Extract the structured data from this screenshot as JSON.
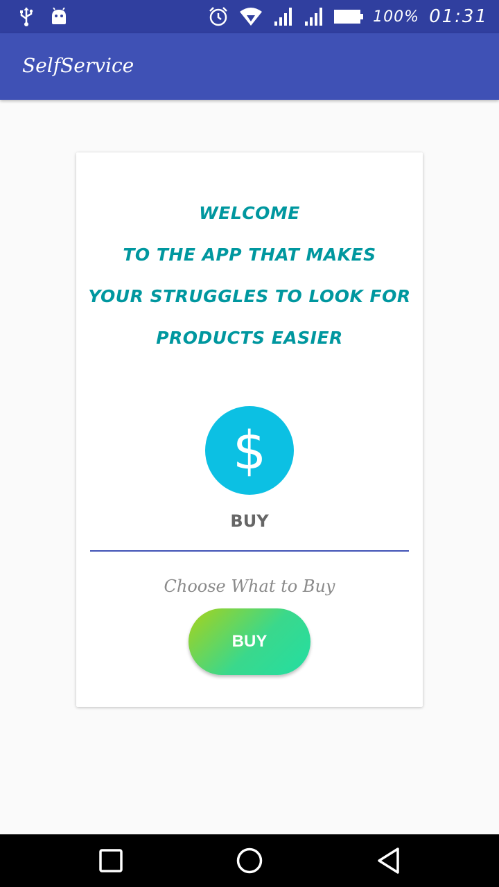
{
  "status_bar": {
    "battery_text": "100%",
    "time": "01:31",
    "icons": [
      "usb-icon",
      "android-icon",
      "alarm-icon",
      "wifi-icon",
      "signal-icon",
      "signal-icon",
      "battery-icon"
    ]
  },
  "app_bar": {
    "title": "SelfService",
    "color": "#3F51B5"
  },
  "card": {
    "welcome_lines": [
      "WELCOME",
      "TO THE APP THAT  MAKES",
      "YOUR STRUGGLES TO LOOK FOR",
      "PRODUCTS EASIER"
    ],
    "icon": "dollar-icon",
    "icon_symbol": "$",
    "buy_label": "BUY",
    "hint": "Choose What to Buy",
    "buy_button_label": "BUY",
    "accent_text_color": "#00979F",
    "circle_color": "#0CC0E3"
  },
  "nav_bar": {
    "icons": [
      "recents-icon",
      "home-icon",
      "back-icon"
    ]
  }
}
